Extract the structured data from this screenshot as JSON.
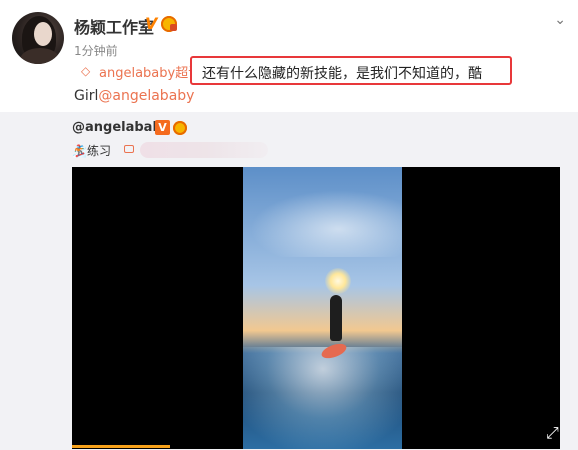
{
  "post": {
    "author": "杨颖工作室",
    "verified_badge": "V",
    "timestamp": "1分钟前",
    "supertopic": "angelababy超话",
    "highlight_text": "还有什么隐藏的新技能，是我们不知道的，酷",
    "line2_prefix": "Girl",
    "line2_mention": "@angelababy"
  },
  "repost": {
    "author": "@angelababy",
    "verified_badge": "V",
    "text": "🏂练习"
  },
  "video": {
    "progress_fraction": 0.2
  },
  "icons": {
    "menu": "chevron-down-icon",
    "supertopic": "supertopic-icon",
    "video": "video-icon",
    "expand": "expand-icon"
  }
}
